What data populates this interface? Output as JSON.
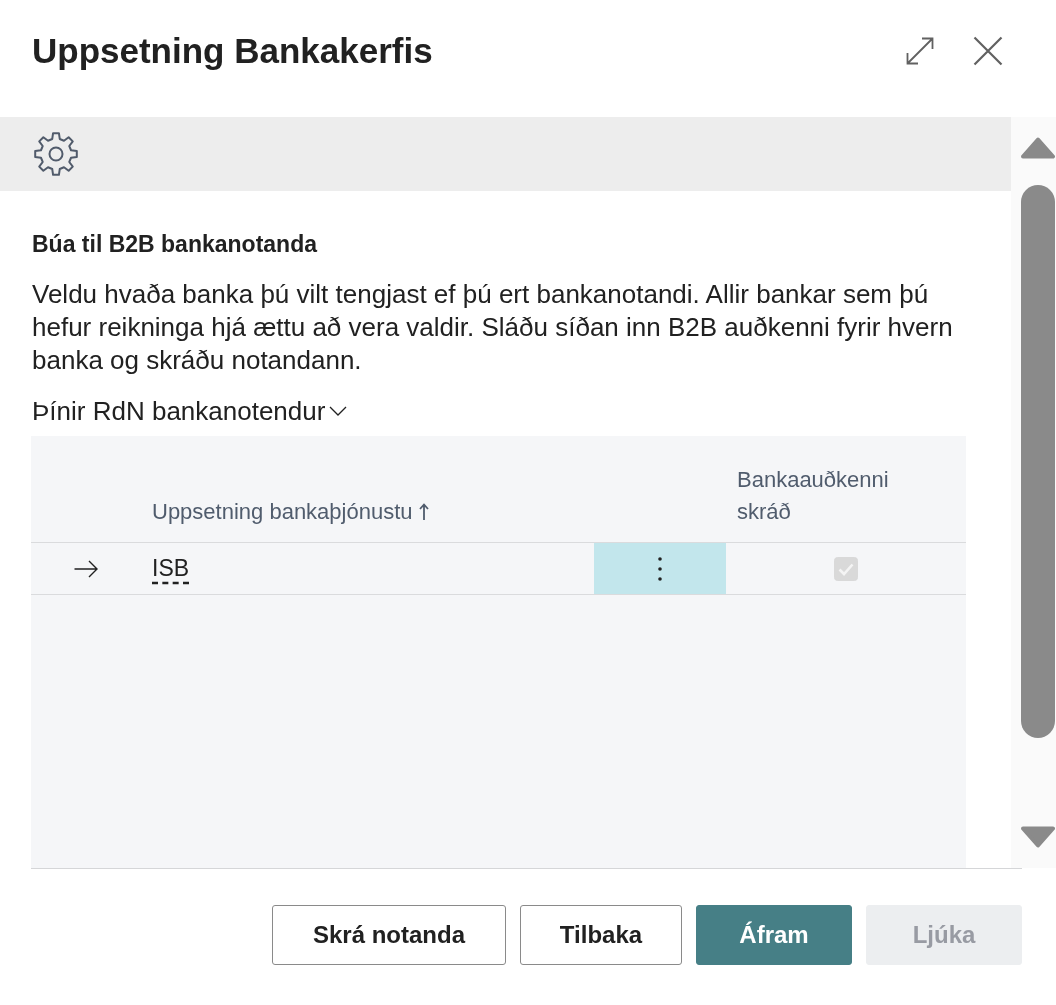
{
  "dialog": {
    "title": "Uppsetning Bankakerfis"
  },
  "section": {
    "heading": "Búa til B2B bankanotanda",
    "description": "Veldu hvaða banka þú vilt tengjast ef þú ert bankanotandi. Allir bankar sem þú hefur reikninga hjá ættu að vera valdir. Sláðu síðan inn B2B auðkenni fyrir hvern banka og skráðu notandann."
  },
  "group": {
    "label": "Þínir RdN bankanotendur",
    "expanded": true
  },
  "table": {
    "columns": [
      {
        "label": "Uppsetning bankaþjónustu",
        "sorted": true
      },
      {
        "label": "Bankaauðkenni skráð",
        "sorted": false
      }
    ],
    "rows": [
      {
        "selected": true,
        "name": "ISB",
        "registered": {
          "checked": true,
          "disabled": true
        }
      }
    ]
  },
  "buttons": [
    {
      "label": "Skrá notanda",
      "kind": "secondary",
      "disabled": false
    },
    {
      "label": "Tilbaka",
      "kind": "secondary",
      "disabled": false
    },
    {
      "label": "Áfram",
      "kind": "primary",
      "disabled": false
    },
    {
      "label": "Ljúka",
      "kind": "primary",
      "disabled": true
    }
  ]
}
